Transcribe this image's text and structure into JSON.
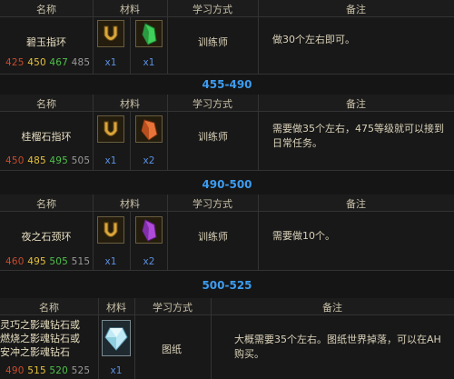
{
  "headers": {
    "name": "名称",
    "materials": "材料",
    "method": "学习方式",
    "notes": "备注"
  },
  "recipes": [
    {
      "name": "碧玉指环",
      "levels": [
        "425",
        "450",
        "467",
        "485"
      ],
      "materials": [
        {
          "icon": "vial-icon",
          "qty": "x1"
        },
        {
          "icon": "green-gem-icon",
          "qty": "x1"
        }
      ],
      "method": "训练师",
      "note": "做30个左右即可。"
    },
    {
      "range": "455-490",
      "name": "桂榴石指环",
      "levels": [
        "450",
        "485",
        "495",
        "505"
      ],
      "materials": [
        {
          "icon": "vial-icon",
          "qty": "x1"
        },
        {
          "icon": "orange-gem-icon",
          "qty": "x2"
        }
      ],
      "method": "训练师",
      "note": "需要做35个左右，475等级就可以接到日常任务。"
    },
    {
      "range": "490-500",
      "name": "夜之石颈环",
      "levels": [
        "460",
        "495",
        "505",
        "515"
      ],
      "materials": [
        {
          "icon": "vial-icon",
          "qty": "x1"
        },
        {
          "icon": "purple-gem-icon",
          "qty": "x2"
        }
      ],
      "method": "训练师",
      "note": "需要做10个。"
    },
    {
      "range": "500-525",
      "name": "灵巧之影魂钻石或燃烧之影魂钻石或安冲之影魂钻石",
      "name_lines": [
        "灵巧之影魂钻石或",
        "燃烧之影魂钻石或",
        "安冲之影魂钻石"
      ],
      "levels": [
        "490",
        "515",
        "520",
        "525"
      ],
      "materials": [
        {
          "icon": "diamond-icon",
          "qty": "x1"
        }
      ],
      "method": "图纸",
      "note": "大概需要35个左右。图纸世界掉落，可以在AH购买。"
    }
  ]
}
